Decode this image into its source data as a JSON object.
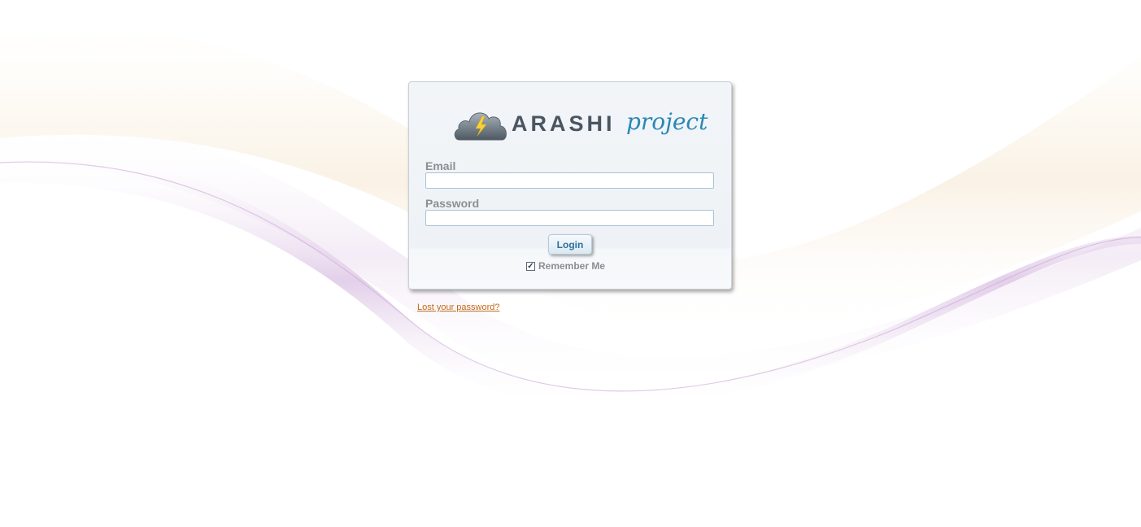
{
  "logo": {
    "title": "ARASHI",
    "subtitle": "project"
  },
  "form": {
    "email_label": "Email",
    "email_value": "",
    "password_label": "Password",
    "password_value": "",
    "login_label": "Login",
    "remember_label": "Remember Me",
    "remember_checked": true,
    "remember_mark": "✓"
  },
  "links": {
    "lost_password": "Lost your password?"
  },
  "colors": {
    "accent": "#2a88b4",
    "link": "#c06a1a",
    "label": "#8b8f93"
  }
}
